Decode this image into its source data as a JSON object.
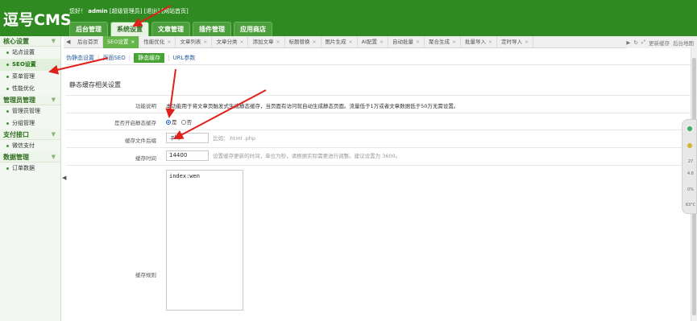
{
  "app": {
    "logo": "逗号CMS",
    "greeting_prefix": "您好！",
    "username": "admin",
    "role": "[超级管理员]",
    "logout": "[退出]",
    "site_home": "[网站首页]"
  },
  "topnav": [
    "后台管理",
    "系统设置",
    "文章管理",
    "插件管理",
    "应用商店"
  ],
  "sidebar": {
    "sections": [
      {
        "title": "核心设置",
        "items": [
          "站点设置",
          "SEO设置",
          "菜单管理",
          "性能优化"
        ]
      },
      {
        "title": "管理员管理",
        "items": [
          "管理员管理",
          "分组管理"
        ]
      },
      {
        "title": "支付接口",
        "items": [
          "微信支付"
        ]
      },
      {
        "title": "数据管理",
        "items": [
          "订单数据"
        ]
      }
    ]
  },
  "tabs": [
    "后台首页",
    "SEO设置",
    "性能优化",
    "文章列表",
    "文章分类",
    "添加文章",
    "标题替换",
    "图片生成",
    "AI配置",
    "自动批量",
    "聚合生成",
    "批量导入",
    "定时导入"
  ],
  "tabtools": {
    "refresh": "↻",
    "fullscreen": "⤢",
    "clear_cache": "更新缓存",
    "admin_map": "后台地图"
  },
  "subtabs": [
    "伪静态设置",
    "页面SEO",
    "静态缓存",
    "URL参数"
  ],
  "section_title": "静态缓存相关设置",
  "form": {
    "desc_label": "功能说明",
    "desc_text": "本功能用于将文章页触发式生成静态缓存，当页面有访问就自动生成静态页面。流量低于1万或者文章数据低于50万无需设置。",
    "enable_label": "是否开启静态缓存",
    "opt_yes": "是",
    "opt_no": "否",
    "suffix_label": "缓存文件后缀",
    "suffix_value": ".php",
    "suffix_hint": "比如：.html .php",
    "time_label": "缓存时间",
    "time_value": "14400",
    "time_hint": "设置缓存更新的时间，单位为秒，请根据实际需要进行调整。建议设置为 3600。",
    "rule_label": "缓存规则",
    "rule_value": "index:wen"
  },
  "widget": {
    "v1": "27",
    "v2": "4.6",
    "v3": "0%",
    "v4": "63°C"
  }
}
